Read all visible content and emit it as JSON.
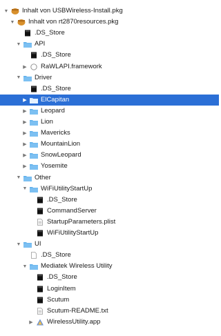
{
  "items": [
    {
      "label": "Inhalt von USBWireless-Install.pkg",
      "depth": 0,
      "disclosure": "open",
      "icon": "package-icon"
    },
    {
      "label": "Inhalt von rt2870resources.pkg",
      "depth": 1,
      "disclosure": "open",
      "icon": "package-icon"
    },
    {
      "label": ".DS_Store",
      "depth": 2,
      "disclosure": "none",
      "icon": "black-file-icon"
    },
    {
      "label": "API",
      "depth": 2,
      "disclosure": "open",
      "icon": "folder-icon"
    },
    {
      "label": ".DS_Store",
      "depth": 3,
      "disclosure": "none",
      "icon": "black-file-icon"
    },
    {
      "label": "RaWLAPI.framework",
      "depth": 3,
      "disclosure": "closed",
      "icon": "framework-icon"
    },
    {
      "label": "Driver",
      "depth": 2,
      "disclosure": "open",
      "icon": "folder-icon"
    },
    {
      "label": ".DS_Store",
      "depth": 3,
      "disclosure": "none",
      "icon": "black-file-icon"
    },
    {
      "label": "ElCapitan",
      "depth": 3,
      "disclosure": "closed",
      "icon": "folder-icon",
      "selected": true
    },
    {
      "label": "Leopard",
      "depth": 3,
      "disclosure": "closed",
      "icon": "folder-icon"
    },
    {
      "label": "Lion",
      "depth": 3,
      "disclosure": "closed",
      "icon": "folder-icon"
    },
    {
      "label": "Mavericks",
      "depth": 3,
      "disclosure": "closed",
      "icon": "folder-icon"
    },
    {
      "label": "MountainLion",
      "depth": 3,
      "disclosure": "closed",
      "icon": "folder-icon"
    },
    {
      "label": "SnowLeopard",
      "depth": 3,
      "disclosure": "closed",
      "icon": "folder-icon"
    },
    {
      "label": "Yosemite",
      "depth": 3,
      "disclosure": "closed",
      "icon": "folder-icon"
    },
    {
      "label": "Other",
      "depth": 2,
      "disclosure": "open",
      "icon": "folder-icon"
    },
    {
      "label": "WiFiUtilityStartUp",
      "depth": 3,
      "disclosure": "open",
      "icon": "folder-icon"
    },
    {
      "label": ".DS_Store",
      "depth": 4,
      "disclosure": "none",
      "icon": "black-file-icon"
    },
    {
      "label": "CommandServer",
      "depth": 4,
      "disclosure": "none",
      "icon": "black-file-icon"
    },
    {
      "label": "StartupParameters.plist",
      "depth": 4,
      "disclosure": "none",
      "icon": "plist-icon"
    },
    {
      "label": "WiFiUtilityStartUp",
      "depth": 4,
      "disclosure": "none",
      "icon": "black-file-icon"
    },
    {
      "label": "UI",
      "depth": 2,
      "disclosure": "open",
      "icon": "folder-icon"
    },
    {
      "label": ".DS_Store",
      "depth": 3,
      "disclosure": "none",
      "icon": "white-file-icon"
    },
    {
      "label": "Mediatek Wireless Utility",
      "depth": 3,
      "disclosure": "open",
      "icon": "folder-icon"
    },
    {
      "label": ".DS_Store",
      "depth": 4,
      "disclosure": "none",
      "icon": "black-file-icon"
    },
    {
      "label": "LoginItem",
      "depth": 4,
      "disclosure": "none",
      "icon": "black-file-icon"
    },
    {
      "label": "Scutum",
      "depth": 4,
      "disclosure": "none",
      "icon": "black-file-icon"
    },
    {
      "label": "Scutum-README.txt",
      "depth": 4,
      "disclosure": "none",
      "icon": "text-file-icon"
    },
    {
      "label": "WirelessUtility.app",
      "depth": 4,
      "disclosure": "closed",
      "icon": "app-icon"
    }
  ],
  "colors": {
    "selection": "#2b6fd6",
    "folder": "#5fb0ec",
    "package": "#d8902c"
  }
}
